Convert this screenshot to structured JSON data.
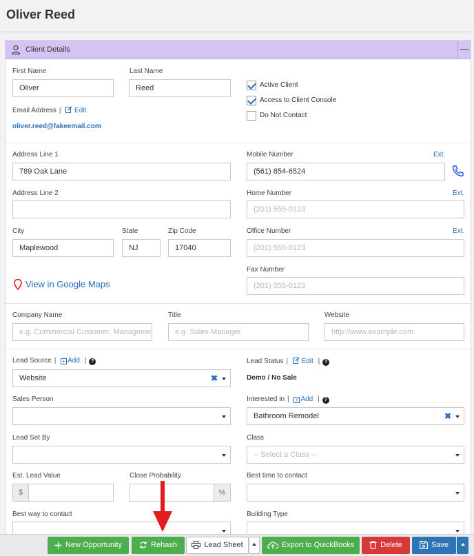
{
  "page_title": "Oliver Reed",
  "panel": {
    "title": "Client Details",
    "collapse": "—"
  },
  "contact": {
    "first_name_label": "First Name",
    "first_name": "Oliver",
    "last_name_label": "Last Name",
    "last_name": "Reed",
    "email_label": "Email Address",
    "email_edit": "Edit",
    "email": "oliver.reed@fakeemail.com",
    "checkboxes": [
      {
        "label": "Active Client",
        "checked": true
      },
      {
        "label": "Access to Client Console",
        "checked": true
      },
      {
        "label": "Do Not Contact",
        "checked": false
      }
    ]
  },
  "address": {
    "line1_label": "Address Line 1",
    "line1": "789 Oak Lane",
    "line2_label": "Address Line 2",
    "line2": "",
    "city_label": "City",
    "city": "Maplewood",
    "state_label": "State",
    "state": "NJ",
    "zip_label": "Zip Code",
    "zip": "17040",
    "maps_link": "View in Google Maps"
  },
  "phones": {
    "ext_label": "Ext.",
    "mobile_label": "Mobile Number",
    "mobile": "(561) 854-6524",
    "home_label": "Home Number",
    "home_placeholder": "(201) 555-0123",
    "office_label": "Office Number",
    "office_placeholder": "(201) 555-0123",
    "fax_label": "Fax Number",
    "fax_placeholder": "(201) 555-0123"
  },
  "company": {
    "company_label": "Company Name",
    "company_placeholder": "e.g. Commercial Customer, Management",
    "title_label": "Title",
    "title_placeholder": "e.g. Sales Manager",
    "website_label": "Website",
    "website_placeholder": "http://www.example.com"
  },
  "lead": {
    "source_label": "Lead Source",
    "add": "Add",
    "source_value": "Website",
    "status_label": "Lead Status",
    "status_edit": "Edit",
    "status_value": "Demo / No Sale",
    "sales_person_label": "Sales Person",
    "interested_label": "Interested in",
    "interested_value": "Bathroom Remodel",
    "set_by_label": "Lead Set By",
    "class_label": "Class",
    "class_placeholder": "-- Select a Class --",
    "value_label": "Est. Lead Value",
    "currency_symbol": "$",
    "probability_label": "Close Probability",
    "percent_symbol": "%",
    "best_time_label": "Best time to contact",
    "best_way_label": "Best way to contact",
    "building_label": "Building Type",
    "help": "?"
  },
  "toolbar": {
    "new_opportunity": "New Opportunity",
    "rehash": "Rehash",
    "lead_sheet": "Lead Sheet",
    "export": "Export to QuickBooks",
    "delete": "Delete",
    "save": "Save"
  },
  "colors": {
    "accent": "#2a6ebd",
    "panel_header": "#d5c3f3",
    "green": "#4cae4c",
    "red": "#d9383a",
    "blue": "#2e75b6",
    "annotation_arrow": "#e01e1e"
  }
}
